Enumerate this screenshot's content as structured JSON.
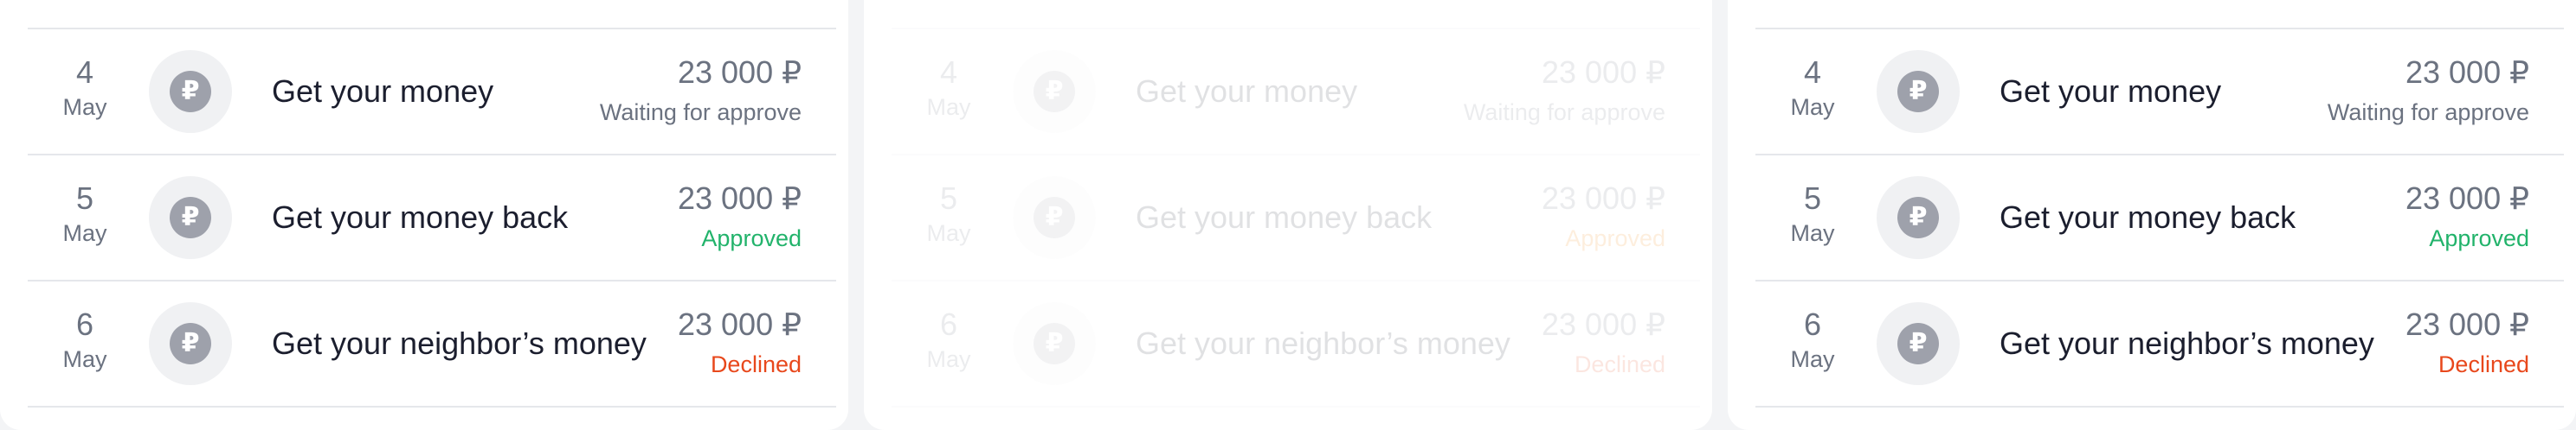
{
  "colors": {
    "approved": "#22b36b",
    "approved_alt": "#f08000",
    "declined": "#e8481c",
    "muted": "#6b7280",
    "coin": "#9ea1ab"
  },
  "cards": [
    {
      "rows": [
        {
          "day": "4",
          "month": "May",
          "icon": "ruble-coin-icon",
          "title": "Get your money",
          "amount": "23 000 ₽",
          "status": "Waiting for approve",
          "status_type": "waiting"
        },
        {
          "day": "5",
          "month": "May",
          "icon": "ruble-coin-icon",
          "title": "Get your money back",
          "amount": "23 000 ₽",
          "status": "Approved",
          "status_type": "approved"
        },
        {
          "day": "6",
          "month": "May",
          "icon": "ruble-coin-icon",
          "title": "Get your neighbor’s money",
          "amount": "23 000 ₽",
          "status": "Declined",
          "status_type": "declined"
        }
      ]
    },
    {
      "rows": [
        {
          "day": "4",
          "month": "May",
          "icon": "ruble-coin-icon",
          "title": "Get your money",
          "amount": "23 000 ₽",
          "status": "Waiting for approve",
          "status_type": "waiting"
        },
        {
          "day": "5",
          "month": "May",
          "icon": "ruble-coin-icon",
          "title": "Get your money back",
          "amount": "23 000 ₽",
          "status": "Approved",
          "status_type": "approved"
        },
        {
          "day": "6",
          "month": "May",
          "icon": "ruble-coin-icon",
          "title": "Get your neighbor’s money",
          "amount": "23 000 ₽",
          "status": "Declined",
          "status_type": "declined"
        }
      ]
    },
    {
      "rows": [
        {
          "day": "4",
          "month": "May",
          "icon": "ruble-coin-icon",
          "title": "Get your money",
          "amount": "23 000 ₽",
          "status": "Waiting for approve",
          "status_type": "waiting"
        },
        {
          "day": "5",
          "month": "May",
          "icon": "ruble-coin-icon",
          "title": "Get your money back",
          "amount": "23 000 ₽",
          "status": "Approved",
          "status_type": "approved"
        },
        {
          "day": "6",
          "month": "May",
          "icon": "ruble-coin-icon",
          "title": "Get your neighbor’s money",
          "amount": "23 000 ₽",
          "status": "Declined",
          "status_type": "declined"
        }
      ]
    }
  ],
  "currency_glyph": "₽"
}
